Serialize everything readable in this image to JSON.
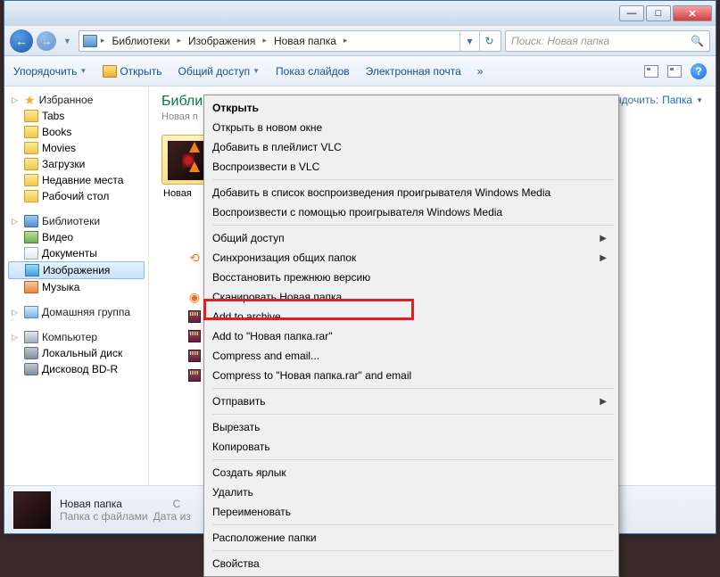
{
  "titlebar": {
    "min": "—",
    "max": "□",
    "close": "✕"
  },
  "nav": {
    "back": "←",
    "fwd": "→"
  },
  "breadcrumb": {
    "segs": [
      "Библиотеки",
      "Изображения",
      "Новая папка"
    ]
  },
  "search": {
    "placeholder": "Поиск: Новая папка"
  },
  "toolbar": {
    "organize": "Упорядочить",
    "open": "Открыть",
    "share": "Общий доступ",
    "slideshow": "Показ слайдов",
    "email": "Электронная почта",
    "more": "»",
    "help": "?"
  },
  "sidebar": {
    "fav": "Избранное",
    "fav_items": [
      "Tabs",
      "Books",
      "Movies",
      "Загрузки",
      "Недавние места",
      "Рабочий стол"
    ],
    "libs": "Библиотеки",
    "lib_items": [
      "Видео",
      "Документы",
      "Изображения",
      "Музыка"
    ],
    "homegroup": "Домашняя группа",
    "computer": "Компьютер",
    "comp_items": [
      "Локальный диск",
      "Дисковод BD-R"
    ]
  },
  "content": {
    "title": "Библиотека \"Изображения\"",
    "sub": "Новая п",
    "arrange": "Упорядочить:",
    "arrange_val": "Папка",
    "thumb": "Новая"
  },
  "status": {
    "name": "Новая папка",
    "type": "Папка с файлами",
    "date_lbl": "Дата из",
    "state": "С"
  },
  "ctx": {
    "open": "Открыть",
    "open_new": "Открыть в новом окне",
    "vlc_add": "Добавить в плейлист VLC",
    "vlc_play": "Воспроизвести в VLC",
    "wmp_add": "Добавить в список воспроизведения проигрывателя Windows Media",
    "wmp_play": "Воспроизвести с помощью проигрывателя Windows Media",
    "share": "Общий доступ",
    "sync": "Синхронизация общих папок",
    "restore": "Восстановить прежнюю версию",
    "scan": "Сканировать Новая папка",
    "add_archive": "Add to archive...",
    "add_rar": "Add to \"Новая папка.rar\"",
    "compress": "Compress and email...",
    "compress_to": "Compress to \"Новая папка.rar\" and email",
    "send": "Отправить",
    "cut": "Вырезать",
    "copy": "Копировать",
    "shortcut": "Создать ярлык",
    "delete": "Удалить",
    "rename": "Переименовать",
    "location": "Расположение папки",
    "props": "Свойства"
  }
}
